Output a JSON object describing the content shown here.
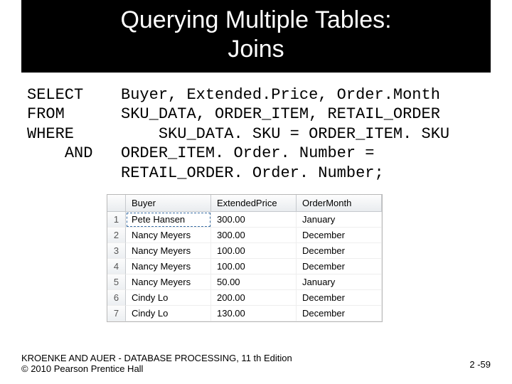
{
  "title_line1": "Querying Multiple Tables:",
  "title_line2": "Joins",
  "sql": {
    "kw_select": "SELECT",
    "select_list": "Buyer, Extended.Price, Order.Month",
    "kw_from": "FROM",
    "from_list": "SKU_DATA, ORDER_ITEM, RETAIL_ORDER",
    "kw_where": "WHERE",
    "where_cond": "SKU_DATA. SKU = ORDER_ITEM. SKU",
    "kw_and": "AND",
    "and_cond1": "ORDER_ITEM. Order. Number =",
    "and_cond2": "RETAIL_ORDER. Order. Number;"
  },
  "table": {
    "headers": [
      "Buyer",
      "ExtendedPrice",
      "OrderMonth"
    ],
    "rows": [
      {
        "n": "1",
        "buyer": "Pete Hansen",
        "price": "300.00",
        "month": "January"
      },
      {
        "n": "2",
        "buyer": "Nancy Meyers",
        "price": "300.00",
        "month": "December"
      },
      {
        "n": "3",
        "buyer": "Nancy Meyers",
        "price": "100.00",
        "month": "December"
      },
      {
        "n": "4",
        "buyer": "Nancy Meyers",
        "price": "100.00",
        "month": "December"
      },
      {
        "n": "5",
        "buyer": "Nancy Meyers",
        "price": "50.00",
        "month": "January"
      },
      {
        "n": "6",
        "buyer": "Cindy Lo",
        "price": "200.00",
        "month": "December"
      },
      {
        "n": "7",
        "buyer": "Cindy Lo",
        "price": "130.00",
        "month": "December"
      }
    ]
  },
  "chart_data": {
    "type": "table",
    "columns": [
      "Buyer",
      "ExtendedPrice",
      "OrderMonth"
    ],
    "data": [
      [
        "Pete Hansen",
        300.0,
        "January"
      ],
      [
        "Nancy Meyers",
        300.0,
        "December"
      ],
      [
        "Nancy Meyers",
        100.0,
        "December"
      ],
      [
        "Nancy Meyers",
        100.0,
        "December"
      ],
      [
        "Nancy Meyers",
        50.0,
        "January"
      ],
      [
        "Cindy Lo",
        200.0,
        "December"
      ],
      [
        "Cindy Lo",
        130.0,
        "December"
      ]
    ]
  },
  "footer": {
    "source": "KROENKE AND AUER - DATABASE PROCESSING, 11 th Edition",
    "copyright": "© 2010 Pearson Prentice Hall",
    "page": "2 -59"
  }
}
